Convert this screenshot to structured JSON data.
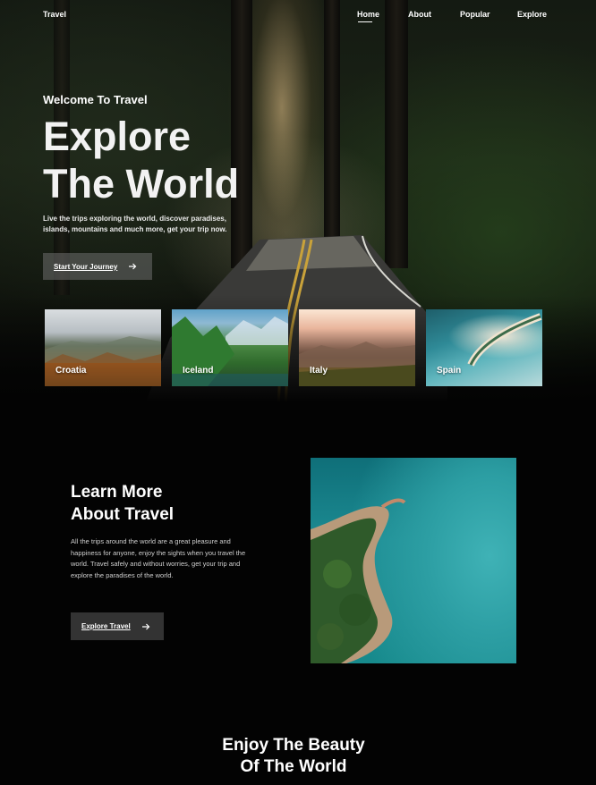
{
  "brand": "Travel",
  "nav": {
    "items": [
      "Home",
      "About",
      "Popular",
      "Explore"
    ],
    "active": "Home"
  },
  "hero": {
    "welcome": "Welcome To Travel",
    "headline_line1": "Explore",
    "headline_line2": "The World",
    "intro_line1": "Live the trips exploring the world, discover paradises,",
    "intro_line2": "islands, mountains and much more, get your trip now.",
    "cta_label": "Start Your Journey"
  },
  "destinations": [
    {
      "name": "Croatia"
    },
    {
      "name": "Iceland"
    },
    {
      "name": "Italy"
    },
    {
      "name": "Spain"
    }
  ],
  "about": {
    "title_line1": "Learn More",
    "title_line2": "About Travel",
    "text": "All the trips around the world are a great pleasure and happiness for anyone, enjoy the sights when you travel the world. Travel safely and without worries, get your trip and explore the paradises of the world.",
    "cta_label": "Explore Travel"
  },
  "enjoy": {
    "line1": "Enjoy The Beauty",
    "line2": "Of The World"
  },
  "icons": {
    "cta_arrow": "arrow-right-icon"
  },
  "colors": {
    "background": "#030303",
    "text": "#ffffff",
    "button": "#333333"
  }
}
